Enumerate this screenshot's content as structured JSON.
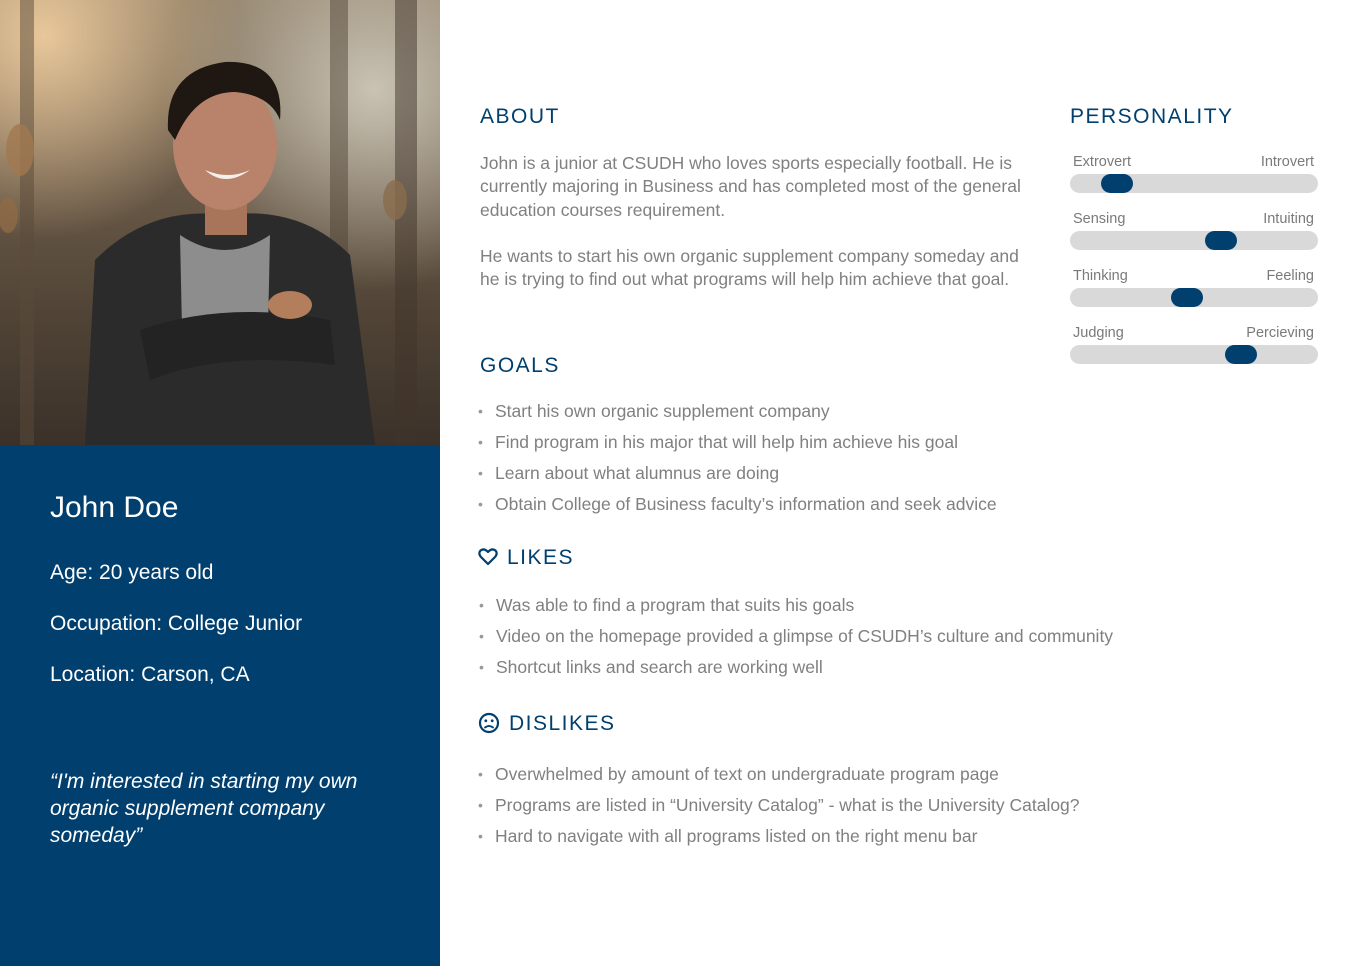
{
  "persona": {
    "name": "John Doe",
    "age": "Age: 20 years old",
    "occupation": "Occupation: College Junior",
    "location": "Location: Carson, CA",
    "quote": "“I'm interested in starting my own organic supplement company someday”"
  },
  "about": {
    "title": "ABOUT",
    "paragraphs": [
      "John is a junior at CSUDH who loves sports especially football. He is currently majoring in Business and has completed most of the general education courses requirement.",
      "He wants to start his own organic supplement company someday and he is trying to find out what programs will help him achieve that goal."
    ]
  },
  "goals": {
    "title": "GOALS",
    "items": [
      "Start his own organic supplement company",
      "Find program in his major that will help him achieve his goal",
      "Learn about what alumnus are doing",
      "Obtain College of Business faculty’s information and seek advice"
    ]
  },
  "likes": {
    "title": "LIKES",
    "icon": "heart-icon",
    "items": [
      "Was able to find a program that suits his goals",
      "Video on the homepage provided a glimpse of CSUDH’s culture and community",
      "Shortcut links and search are working well"
    ]
  },
  "dislikes": {
    "title": "DISLIKES",
    "icon": "sad-face-icon",
    "items": [
      "Overwhelmed by amount of text on undergraduate program page",
      "Programs are listed in “University Catalog” - what is the University Catalog?",
      "Hard to navigate with all programs listed on the right menu bar"
    ]
  },
  "personality": {
    "title": "PERSONALITY",
    "traits": [
      {
        "left": "Extrovert",
        "right": "Introvert",
        "value": 0.19
      },
      {
        "left": "Sensing",
        "right": "Intuiting",
        "value": 0.61
      },
      {
        "left": "Thinking",
        "right": "Feeling",
        "value": 0.47
      },
      {
        "left": "Judging",
        "right": "Percieving",
        "value": 0.69
      }
    ]
  },
  "colors": {
    "primary": "#003f6e",
    "body_text": "#808080",
    "track": "#d9d9d9"
  }
}
